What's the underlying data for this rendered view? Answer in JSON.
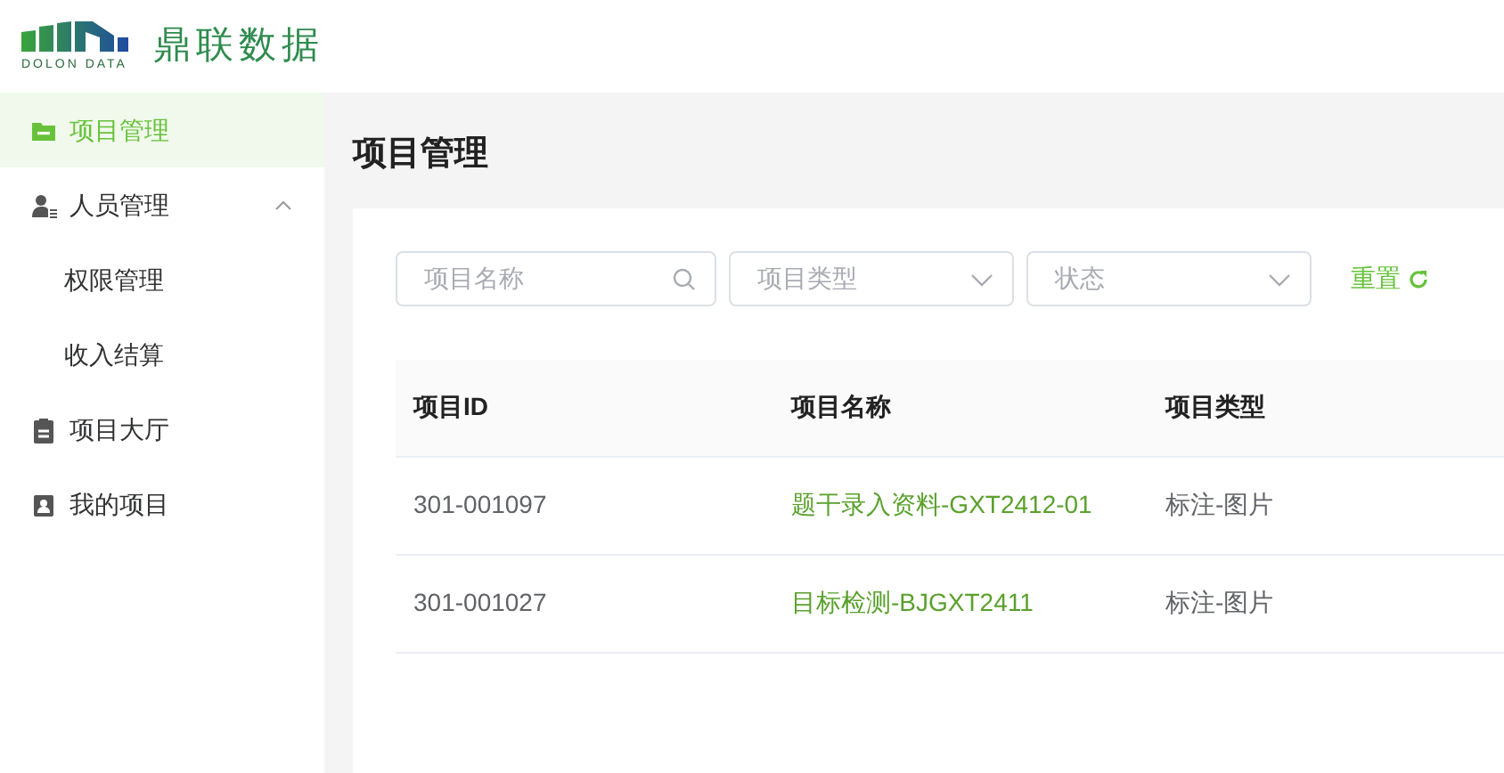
{
  "logo": {
    "name": "鼎联数据",
    "subtitle": "DOLON DATA"
  },
  "sidebar": {
    "items": [
      {
        "label": "项目管理",
        "kind": "folder",
        "selected": true
      },
      {
        "label": "人员管理",
        "kind": "person",
        "selected": false,
        "expanded": true,
        "children": [
          {
            "label": "权限管理",
            "selected": false
          },
          {
            "label": "收入结算",
            "selected": false
          }
        ]
      },
      {
        "label": "项目大厅",
        "kind": "clipboard",
        "selected": false
      },
      {
        "label": "我的项目",
        "kind": "badge",
        "selected": false
      }
    ]
  },
  "page_title": "项目管理",
  "filters": [
    {
      "kind": "search",
      "placeholder": "项目名称"
    },
    {
      "kind": "select",
      "placeholder": "项目类型"
    },
    {
      "kind": "select",
      "placeholder": "状态"
    }
  ],
  "reset_button": "重置",
  "table": {
    "columns": [
      {
        "label": "项目ID",
        "kind": "text"
      },
      {
        "label": "项目名称",
        "kind": "link"
      },
      {
        "label": "项目类型",
        "kind": "text"
      }
    ],
    "rows": [
      [
        "301-001097",
        "题干录入资料-GXT2412-01",
        "标注-图片"
      ],
      [
        "301-001027",
        "目标检测-BJGXT2411",
        "标注-图片"
      ]
    ]
  }
}
